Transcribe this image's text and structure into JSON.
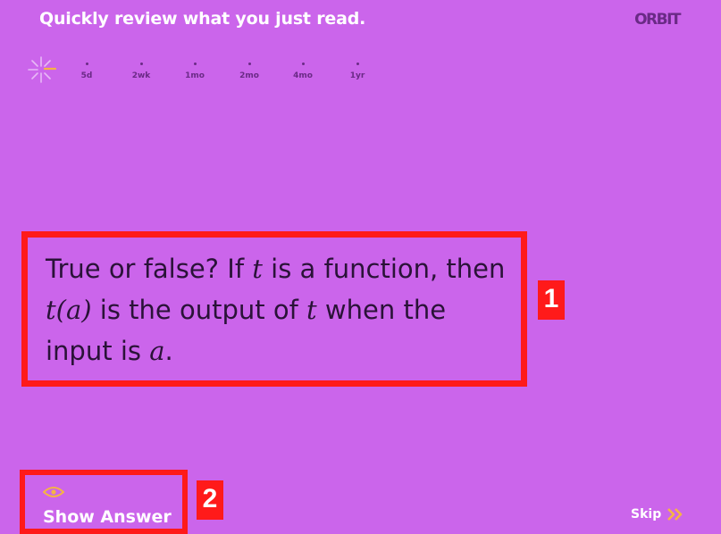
{
  "header": {
    "title": "Quickly review what you just read.",
    "logo": "ORBIT"
  },
  "timeline": {
    "ticks": [
      "5d",
      "2wk",
      "1mo",
      "2mo",
      "4mo",
      "1yr"
    ]
  },
  "question": {
    "part1": "True or false? If ",
    "var_t1": "t",
    "part2": " is a function, then ",
    "expr": "t(a)",
    "part3": " is the output of ",
    "var_t2": "t",
    "part4": " when the input is ",
    "var_a": "a",
    "part5": "."
  },
  "annotations": {
    "badge1": "1",
    "badge2": "2"
  },
  "actions": {
    "show_answer_label": "Show Answer",
    "skip_label": "Skip"
  },
  "colors": {
    "background": "#cb65eb",
    "accent": "#f6b444",
    "highlight": "#ff1a1a",
    "logo": "#6a2a86"
  },
  "icons": [
    "starburst-icon",
    "eye-icon",
    "double-chevron-right-icon"
  ]
}
